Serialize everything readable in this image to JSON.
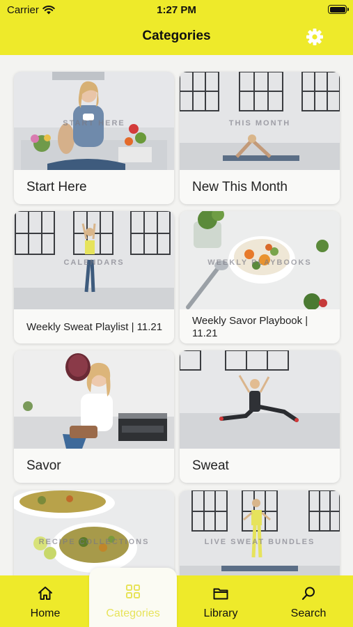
{
  "status_bar": {
    "carrier": "Carrier",
    "time": "1:27 PM"
  },
  "header": {
    "title": "Categories",
    "settings_icon": "gear-icon"
  },
  "categories": [
    {
      "label": "Start Here",
      "overlay": "START HERE"
    },
    {
      "label": "New This Month",
      "overlay": "THIS MONTH"
    },
    {
      "label": "Weekly Sweat Playlist | 11.21",
      "overlay": "CALENDARS"
    },
    {
      "label": "Weekly Savor Playbook | 11.21",
      "overlay": "WEEKLY PLAYBOOKS"
    },
    {
      "label": "Savor",
      "overlay": ""
    },
    {
      "label": "Sweat",
      "overlay": ""
    },
    {
      "label": "",
      "overlay": "RECIPE COLLECTIONS"
    },
    {
      "label": "",
      "overlay": "LIVE SWEAT BUNDLES"
    }
  ],
  "tab_bar": {
    "tabs": [
      {
        "label": "Home",
        "icon": "home-icon"
      },
      {
        "label": "Categories",
        "icon": "grid-icon"
      },
      {
        "label": "Library",
        "icon": "folder-icon"
      },
      {
        "label": "Search",
        "icon": "search-icon"
      }
    ],
    "active_index": 1
  },
  "colors": {
    "brand_yellow": "#eeea2a",
    "active_tab_label": "#e7e35a"
  }
}
